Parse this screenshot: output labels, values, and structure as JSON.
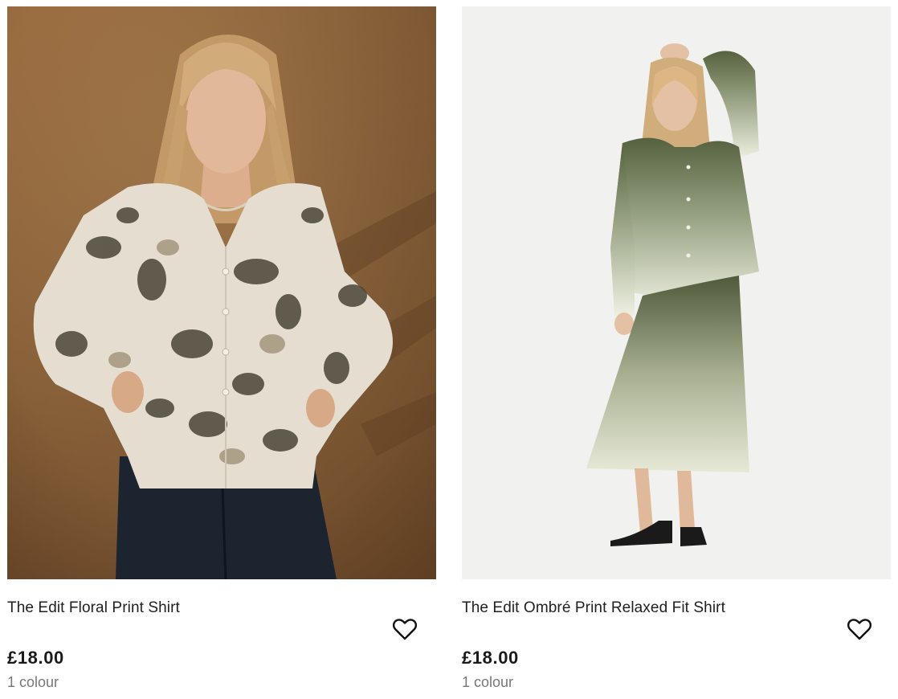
{
  "products": [
    {
      "title": "The Edit Floral Print Shirt",
      "price": "£18.00",
      "colours": "1 colour",
      "wishlist_icon": "heart-outline-icon",
      "image_desc_colors": {
        "bg": "#a87a4c",
        "shirt": "#e4ddd0",
        "pattern": "#4a4536",
        "jeans": "#1c2430",
        "hair": "#c9a272",
        "skin": "#e2b89a"
      }
    },
    {
      "title": "The Edit Ombré Print Relaxed Fit Shirt",
      "price": "£18.00",
      "colours": "1 colour",
      "wishlist_icon": "heart-outline-icon",
      "image_desc_colors": {
        "bg": "#f1f1ef",
        "shirt_dark": "#5e6a4c",
        "shirt_light": "#ecedde",
        "hair": "#d2ad7c",
        "skin": "#e4c0a4",
        "shoes": "#1a1a1a"
      }
    }
  ]
}
